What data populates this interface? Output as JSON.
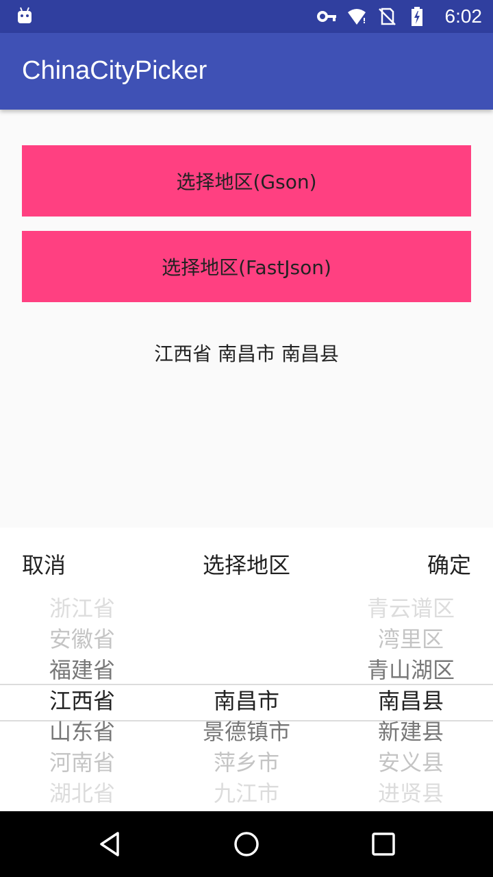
{
  "status_bar": {
    "time": "6:02",
    "icons": [
      "android-icon",
      "vpn-key-icon",
      "wifi-icon",
      "no-sim-icon",
      "battery-charging-icon"
    ]
  },
  "app_bar": {
    "title": "ChinaCityPicker"
  },
  "buttons": {
    "gson_label": "选择地区(Gson)",
    "fastjson_label": "选择地区(FastJson)"
  },
  "result_text": "江西省 南昌市 南昌县",
  "picker": {
    "cancel_label": "取消",
    "title": "选择地区",
    "confirm_label": "确定",
    "provinces": [
      "浙江省",
      "安徽省",
      "福建省",
      "江西省",
      "山东省",
      "河南省",
      "湖北省"
    ],
    "cities": [
      "",
      "",
      "",
      "南昌市",
      "景德镇市",
      "萍乡市",
      "九江市"
    ],
    "districts": [
      "青云谱区",
      "湾里区",
      "青山湖区",
      "南昌县",
      "新建县",
      "安义县",
      "进贤县"
    ],
    "selected": {
      "province": "江西省",
      "city": "南昌市",
      "district": "南昌县"
    }
  },
  "nav_bar": {
    "icons": [
      "back-icon",
      "home-icon",
      "recent-apps-icon"
    ]
  },
  "colors": {
    "status_bar": "#303f9f",
    "app_bar": "#3f51b5",
    "button": "#ff4081",
    "background": "#fafafa"
  }
}
